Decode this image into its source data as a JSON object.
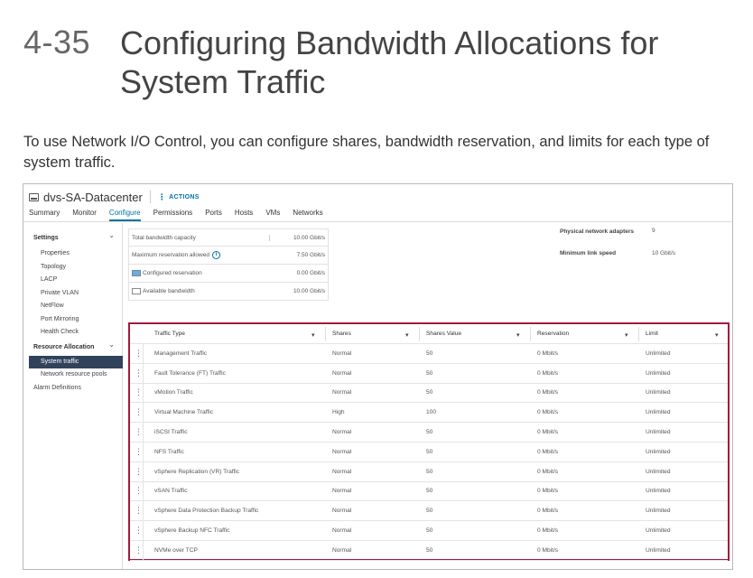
{
  "slide": {
    "number": "4-35",
    "title": "Configuring Bandwidth Allocations for System Traffic",
    "intro": "To use Network I/O Control, you can configure shares, bandwidth reservation, and limits for each type of system traffic."
  },
  "object": {
    "name": "dvs-SA-Datacenter",
    "actions_label": "ACTIONS",
    "icon": "switch-icon"
  },
  "tabs": [
    {
      "label": "Summary",
      "active": false
    },
    {
      "label": "Monitor",
      "active": false
    },
    {
      "label": "Configure",
      "active": true
    },
    {
      "label": "Permissions",
      "active": false
    },
    {
      "label": "Ports",
      "active": false
    },
    {
      "label": "Hosts",
      "active": false
    },
    {
      "label": "VMs",
      "active": false
    },
    {
      "label": "Networks",
      "active": false
    }
  ],
  "sidebar": {
    "settings_label": "Settings",
    "settings_items": [
      "Properties",
      "Topology",
      "LACP",
      "Private VLAN",
      "NetFlow",
      "Port Mirroring",
      "Health Check"
    ],
    "resource_label": "Resource Allocation",
    "resource_items": [
      "System traffic",
      "Network resource pools"
    ],
    "selected": "System traffic",
    "alarm_label": "Alarm Definitions"
  },
  "bandwidth": [
    {
      "label": "Total bandwidth capacity",
      "value": "10.00 Gbit/s"
    },
    {
      "label": "Maximum reservation allowed",
      "value": "7.50 Gbit/s",
      "info": true
    },
    {
      "label": "Configured reservation",
      "value": "0.00 Gbit/s",
      "swatch": "filled"
    },
    {
      "label": "Available bandwidth",
      "value": "10.00 Gbit/s",
      "swatch": "empty"
    }
  ],
  "physical": {
    "adapters_label": "Physical network adapters",
    "adapters_value": "9",
    "speed_label": "Minimum link speed",
    "speed_value": "10 Gbit/s"
  },
  "traffic_table": {
    "columns": [
      "Traffic Type",
      "Shares",
      "Shares Value",
      "Reservation",
      "Limit"
    ],
    "rows": [
      [
        "Management Traffic",
        "Normal",
        "50",
        "0 Mbit/s",
        "Unlimited"
      ],
      [
        "Fault Tolerance (FT) Traffic",
        "Normal",
        "50",
        "0 Mbit/s",
        "Unlimited"
      ],
      [
        "vMotion Traffic",
        "Normal",
        "50",
        "0 Mbit/s",
        "Unlimited"
      ],
      [
        "Virtual Machine Traffic",
        "High",
        "100",
        "0 Mbit/s",
        "Unlimited"
      ],
      [
        "iSCSI Traffic",
        "Normal",
        "50",
        "0 Mbit/s",
        "Unlimited"
      ],
      [
        "NFS Traffic",
        "Normal",
        "50",
        "0 Mbit/s",
        "Unlimited"
      ],
      [
        "vSphere Replication (VR) Traffic",
        "Normal",
        "50",
        "0 Mbit/s",
        "Unlimited"
      ],
      [
        "vSAN Traffic",
        "Normal",
        "50",
        "0 Mbit/s",
        "Unlimited"
      ],
      [
        "vSphere Data Protection Backup Traffic",
        "Normal",
        "50",
        "0 Mbit/s",
        "Unlimited"
      ],
      [
        "vSphere Backup NFC Traffic",
        "Normal",
        "50",
        "0 Mbit/s",
        "Unlimited"
      ],
      [
        "NVMe over TCP",
        "Normal",
        "50",
        "0 Mbit/s",
        "Unlimited"
      ]
    ]
  },
  "colors": {
    "accent": "#0072a3",
    "highlight_border": "#a3193f",
    "selected_bg": "#31435b"
  }
}
